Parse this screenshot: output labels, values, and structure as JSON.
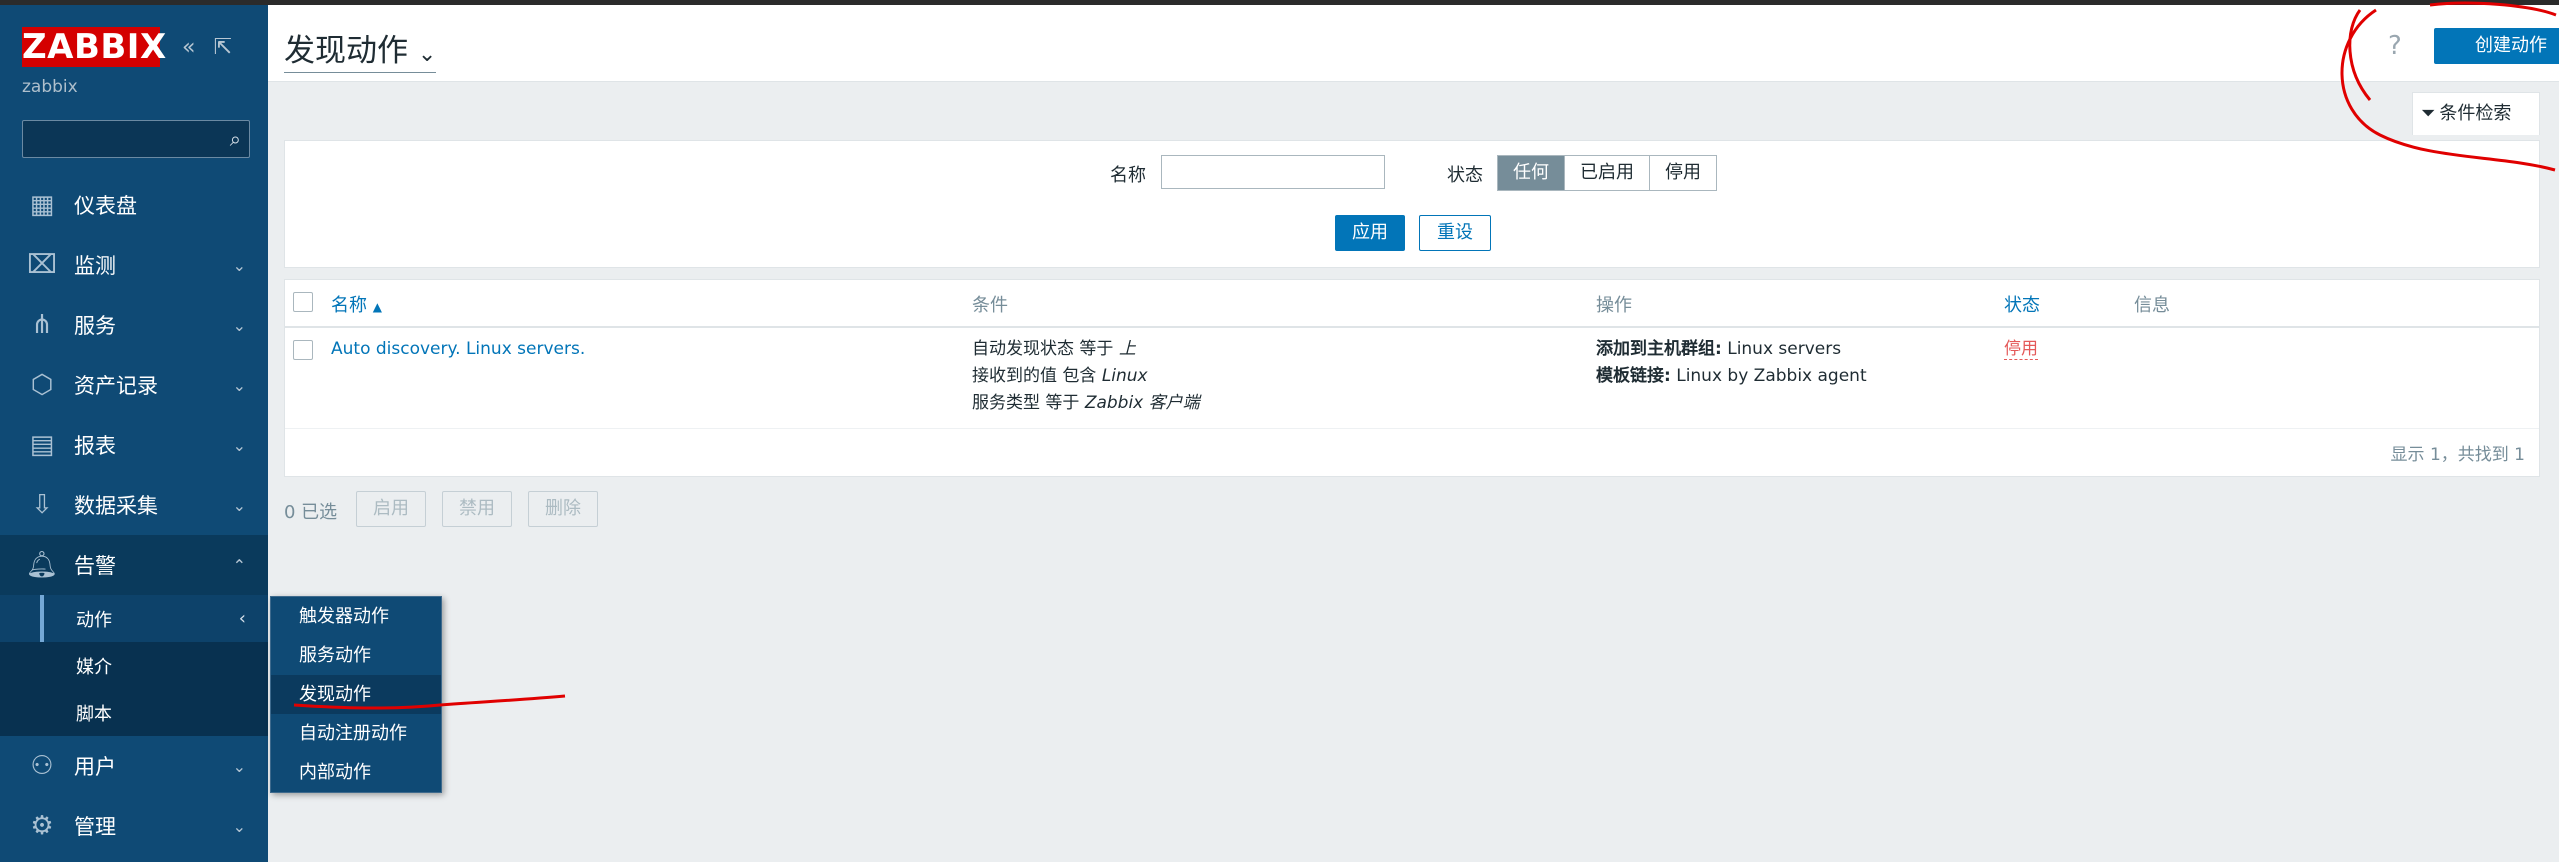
{
  "brand": {
    "logo_text": "ZABBIX",
    "server_name": "zabbix",
    "accent": "#d40000"
  },
  "sidebar": {
    "search_placeholder": "",
    "items": [
      {
        "label": "仪表盘",
        "icon": "dashboard-icon"
      },
      {
        "label": "监测",
        "icon": "monitoring-icon"
      },
      {
        "label": "服务",
        "icon": "services-icon"
      },
      {
        "label": "资产记录",
        "icon": "inventory-icon"
      },
      {
        "label": "报表",
        "icon": "reports-icon"
      },
      {
        "label": "数据采集",
        "icon": "data-collection-icon"
      },
      {
        "label": "告警",
        "icon": "bell-icon"
      },
      {
        "label": "用户",
        "icon": "users-icon"
      },
      {
        "label": "管理",
        "icon": "gear-icon"
      }
    ],
    "alerts_sub": [
      "动作",
      "媒介",
      "脚本"
    ]
  },
  "flyout": {
    "items": [
      "触发器动作",
      "服务动作",
      "发现动作",
      "自动注册动作",
      "内部动作"
    ],
    "selected": "发现动作"
  },
  "header": {
    "title": "发现动作",
    "help": "?",
    "create_button": "创建动作"
  },
  "filter": {
    "tab_label": "条件检索",
    "name_label": "名称",
    "name_value": "",
    "status_label": "状态",
    "status_options": [
      "任何",
      "已启用",
      "停用"
    ],
    "status_selected": "任何",
    "apply": "应用",
    "reset": "重设"
  },
  "table": {
    "columns": [
      "名称",
      "条件",
      "操作",
      "状态",
      "信息"
    ],
    "sort_indicator": "▲",
    "rows": [
      {
        "name": "Auto discovery. Linux servers.",
        "conditions": [
          {
            "text": "自动发现状态 等于 ",
            "value": "上"
          },
          {
            "text": "接收到的值 包含 ",
            "value": "Linux"
          },
          {
            "text": "服务类型 等于 ",
            "value": "Zabbix 客户端"
          }
        ],
        "operations": [
          {
            "label": "添加到主机群组:",
            "value": " Linux servers"
          },
          {
            "label": "模板链接:",
            "value": " Linux by Zabbix agent"
          }
        ],
        "status": "停用",
        "info": ""
      }
    ],
    "footer": "显示 1，共找到 1"
  },
  "actions": {
    "selected_count": "0 已选",
    "enable": "启用",
    "disable": "禁用",
    "delete": "删除"
  }
}
